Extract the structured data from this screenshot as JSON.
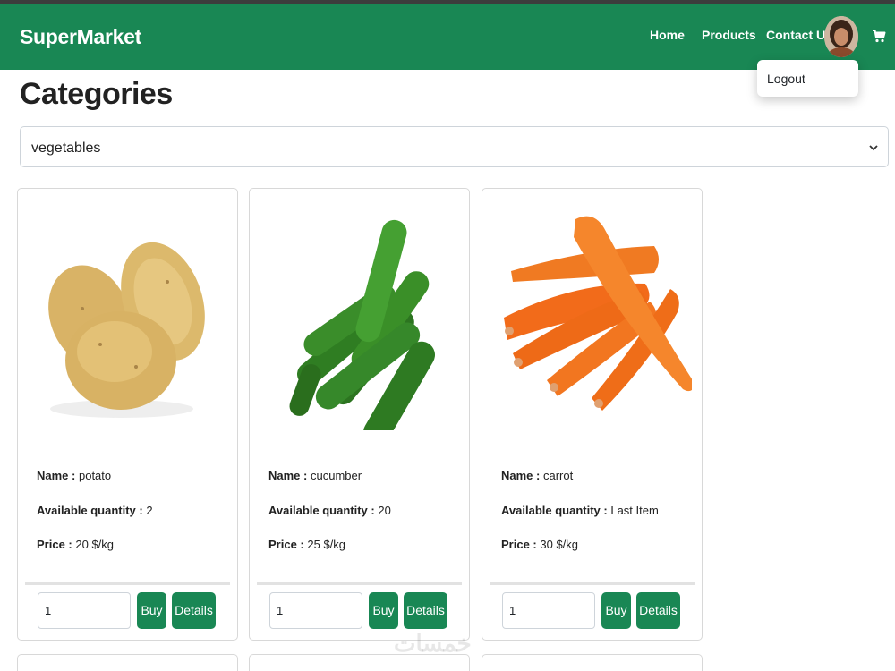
{
  "navbar": {
    "brand": "SuperMarket",
    "links": [
      "Home",
      "Products",
      "Contact Us"
    ],
    "color": "#198754",
    "avatar_icon": "user-avatar",
    "cart_icon": "cart-icon"
  },
  "dropdown": {
    "items": [
      "Logout"
    ]
  },
  "page": {
    "title": "Categories"
  },
  "category_select": {
    "value": "vegetables",
    "icon": "chevron-down-icon"
  },
  "labels": {
    "name": "Name :",
    "quantity": "Available quantity :",
    "price": "Price :",
    "buy": "Buy",
    "details": "Details"
  },
  "products": [
    {
      "name": "potato",
      "quantity": "2",
      "price": "20 $/kg",
      "qty_value": "1",
      "image": "potato-image"
    },
    {
      "name": "cucumber",
      "quantity": "20",
      "price": "25 $/kg",
      "qty_value": "1",
      "image": "cucumber-image"
    },
    {
      "name": "carrot",
      "quantity": "Last Item",
      "price": "30 $/kg",
      "qty_value": "1",
      "image": "carrot-image"
    }
  ],
  "watermark": "خمسات"
}
